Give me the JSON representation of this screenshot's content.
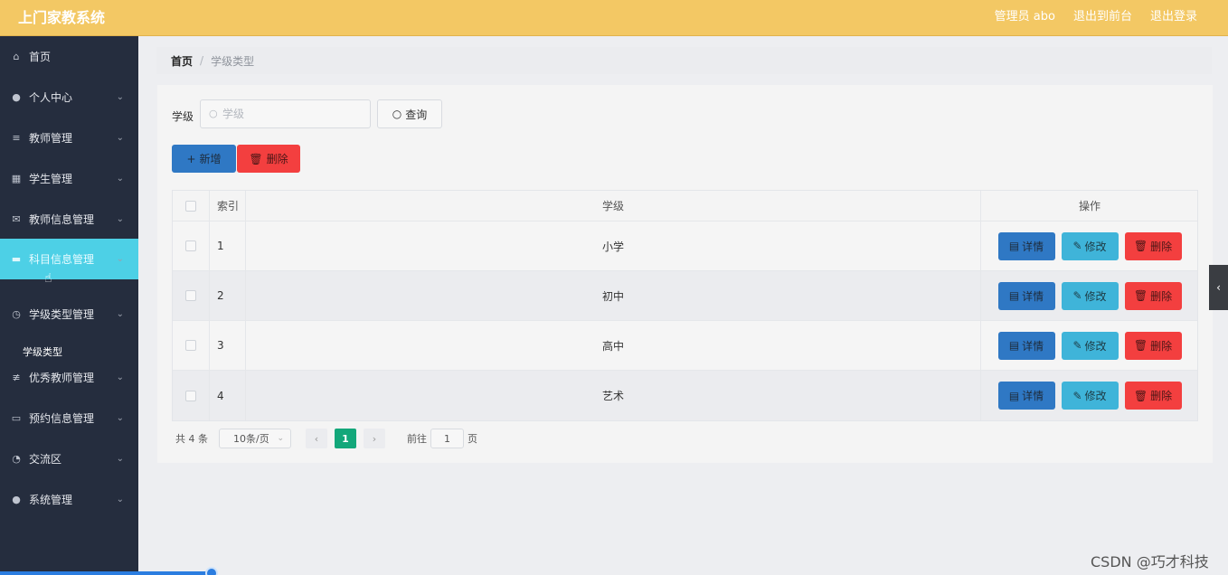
{
  "header": {
    "brand": "上门家教系统",
    "admin": "管理员 abo",
    "to_front": "退出到前台",
    "logout": "退出登录"
  },
  "sidebar": {
    "items": [
      {
        "label": "首页",
        "icon": "home-icon",
        "glyph": "⌂"
      },
      {
        "label": "个人中心",
        "icon": "user-icon",
        "glyph": "●"
      },
      {
        "label": "教师管理",
        "icon": "list-icon",
        "glyph": "≡"
      },
      {
        "label": "学生管理",
        "icon": "chart-icon",
        "glyph": "▦"
      },
      {
        "label": "教师信息管理",
        "icon": "mail-icon",
        "glyph": "✉"
      },
      {
        "label": "科目信息管理",
        "icon": "chat-icon",
        "glyph": "▬"
      },
      {
        "label": "学级类型管理",
        "icon": "clock-icon",
        "glyph": "◷"
      },
      {
        "label": "优秀教师管理",
        "icon": "sliders-icon",
        "glyph": "≢"
      },
      {
        "label": "预约信息管理",
        "icon": "message-icon",
        "glyph": "▭"
      },
      {
        "label": "交流区",
        "icon": "compass-icon",
        "glyph": "◔"
      },
      {
        "label": "系统管理",
        "icon": "bulb-icon",
        "glyph": "●"
      }
    ],
    "sub_item": "学级类型",
    "chevron": "⌄"
  },
  "breadcrumb": {
    "home": "首页",
    "sep": "/",
    "current": "学级类型"
  },
  "search": {
    "label": "学级",
    "placeholder": "学级",
    "button": "查询",
    "icon_glyph": "○"
  },
  "toolbar": {
    "add_label": "新增",
    "add_glyph": "+",
    "delete_label": "删除",
    "delete_glyph": "🗑"
  },
  "table": {
    "columns": [
      "索引",
      "学级",
      "操作"
    ],
    "rows": [
      {
        "index": "1",
        "grade": "小学"
      },
      {
        "index": "2",
        "grade": "初中"
      },
      {
        "index": "3",
        "grade": "高中"
      },
      {
        "index": "4",
        "grade": "艺术"
      }
    ],
    "actions": {
      "detail": "详情",
      "edit": "修改",
      "delete": "删除"
    }
  },
  "pagination": {
    "total": "共 4 条",
    "page_size": "10条/页",
    "prev": "‹",
    "current": "1",
    "next": "›",
    "goto_prefix": "前往",
    "goto_value": "1",
    "goto_suffix": "页"
  },
  "side_tab_glyph": "‹",
  "watermark": "CSDN @巧才科技",
  "colors": {
    "header": "#f3c864",
    "sidebar": "#252d3e",
    "active_menu": "#4dd0e6",
    "primary": "#2f78c4",
    "danger": "#f33f3f",
    "info": "#3fb4d9",
    "page_active": "#13a77a"
  }
}
